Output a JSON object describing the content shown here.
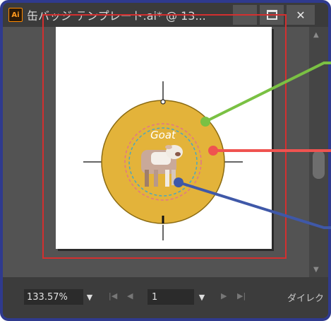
{
  "window": {
    "app_icon_label": "Ai",
    "title": "缶バッジ テンプレート.ai* @ 13...",
    "controls": [
      "minimize",
      "maximize",
      "close"
    ]
  },
  "artwork": {
    "badge_text": "Goat",
    "colors": {
      "badge_fill": "#e3b33a",
      "badge_stroke": "#8a6a12",
      "inner_pink_dash": "#e2748a",
      "inner_teal_dash": "#4aa7c2",
      "bleed_line": "#d32f2f",
      "callout_green": "#7ac143",
      "callout_red": "#ef5350",
      "callout_blue": "#3f58a8"
    }
  },
  "statusbar": {
    "zoom": "133.57%",
    "page": "1",
    "status": "ダイレク"
  },
  "scrollbar": {
    "icons": [
      "chevron-up-icon",
      "chevron-down-icon"
    ]
  }
}
